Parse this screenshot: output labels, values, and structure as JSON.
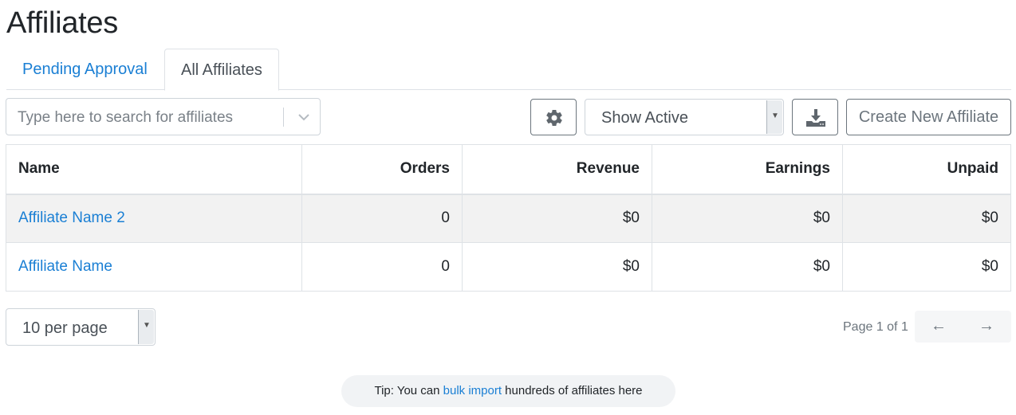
{
  "page": {
    "title": "Affiliates"
  },
  "tabs": [
    {
      "label": "Pending Approval",
      "active": false
    },
    {
      "label": "All Affiliates",
      "active": true
    }
  ],
  "toolbar": {
    "search_placeholder": "Type here to search for affiliates",
    "status_filter": "Show Active",
    "create_label": "Create New Affiliate",
    "icons": {
      "settings": "gear-icon",
      "download": "download-icon",
      "dropdown": "chevron-down-icon"
    }
  },
  "table": {
    "headers": {
      "name": "Name",
      "orders": "Orders",
      "revenue": "Revenue",
      "earnings": "Earnings",
      "unpaid": "Unpaid"
    },
    "rows": [
      {
        "name": "Affiliate Name 2",
        "orders": "0",
        "revenue": "$0",
        "earnings": "$0",
        "unpaid": "$0"
      },
      {
        "name": "Affiliate Name",
        "orders": "0",
        "revenue": "$0",
        "earnings": "$0",
        "unpaid": "$0"
      }
    ]
  },
  "pagination": {
    "per_page": "10 per page",
    "page_info": "Page 1 of 1",
    "prev_icon": "←",
    "next_icon": "→"
  },
  "tip": {
    "prefix": "Tip: You can ",
    "link": "bulk import",
    "suffix": " hundreds of affiliates here"
  },
  "colors": {
    "link": "#1a7fd4",
    "border": "#dee2e6",
    "row_shade": "#f2f2f2"
  }
}
